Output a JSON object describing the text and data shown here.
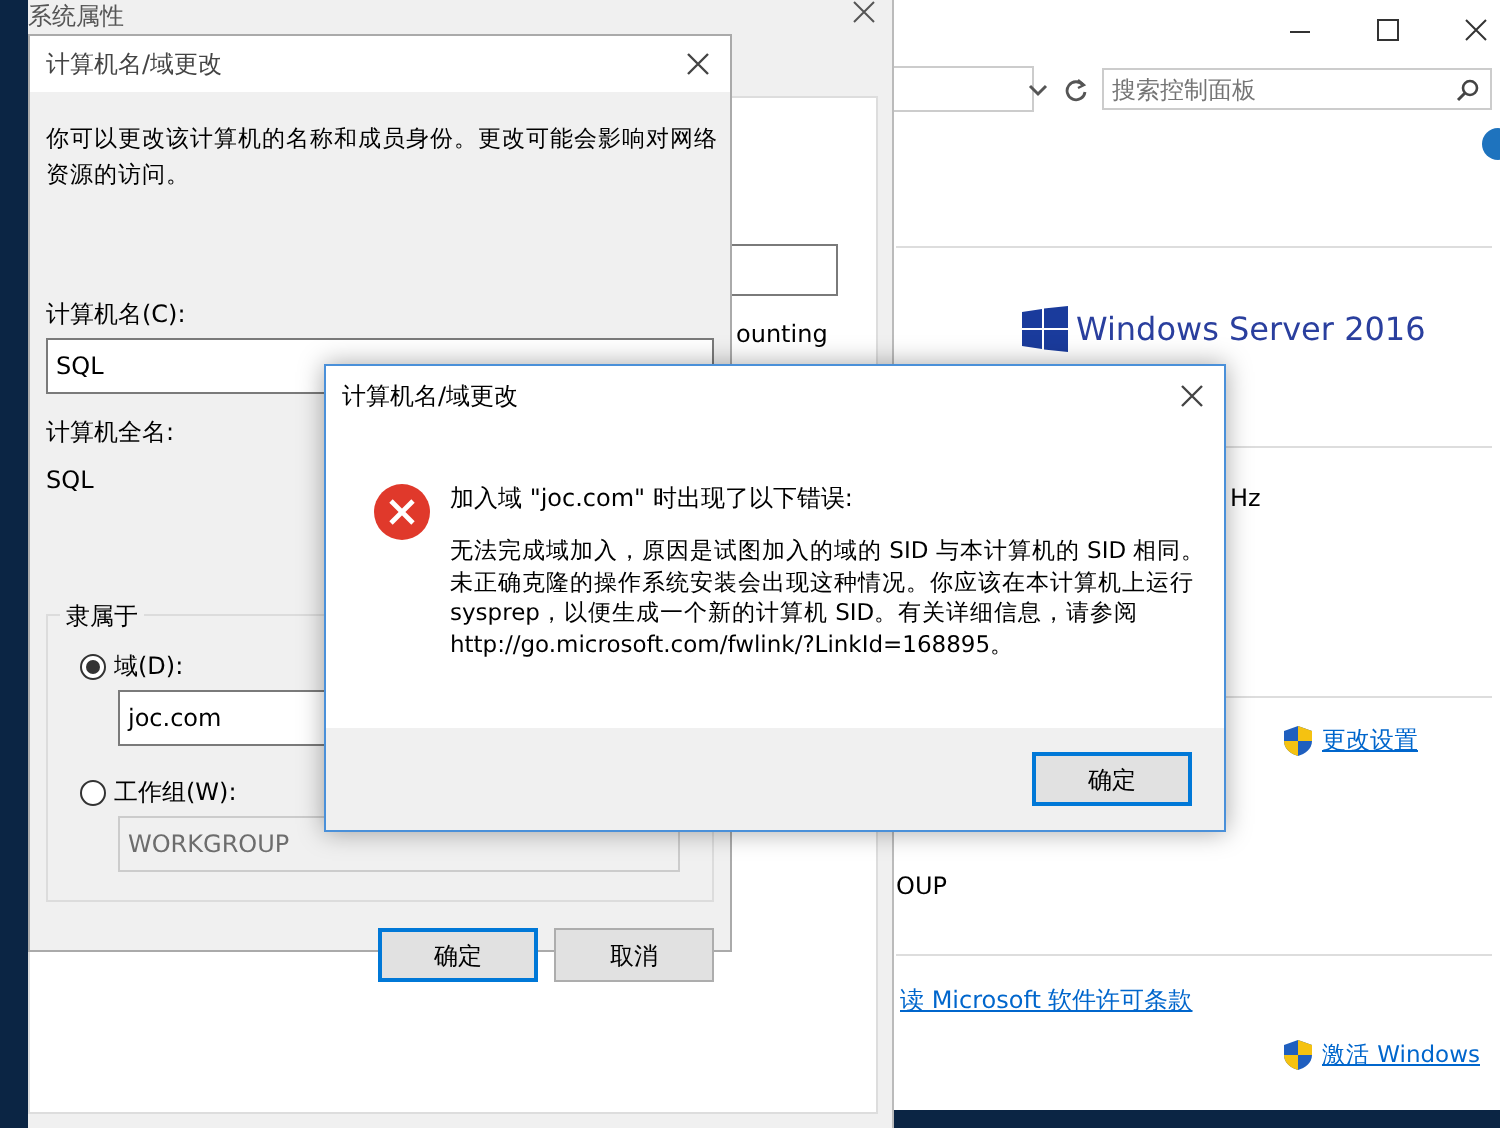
{
  "control_panel": {
    "search": {
      "placeholder": "搜索控制面板"
    },
    "brand": "Windows Server 2016",
    "fragments": [
      "Hz",
      "OUP"
    ],
    "change_settings_link": "更改设置",
    "license_link": "读 Microsoft 软件许可条款",
    "activate_link": "激活 Windows"
  },
  "system_properties": {
    "title": "系统属性",
    "fragment": "ounting"
  },
  "name_dialog": {
    "title": "计算机名/域更改",
    "description": "你可以更改该计算机的名称和成员身份。更改可能会影响对网络资源的访问。",
    "computer_name_label": "计算机名(C):",
    "computer_name": "SQL",
    "full_name_label": "计算机全名:",
    "full_name": "SQL",
    "member_of": "隶属于",
    "options": [
      {
        "label": "域(D):",
        "selected": true,
        "value": "joc.com",
        "disabled": false
      },
      {
        "label": "工作组(W):",
        "selected": false,
        "value": "WORKGROUP",
        "disabled": true
      }
    ],
    "buttons": [
      {
        "label": "确定",
        "default": true
      },
      {
        "label": "取消",
        "default": false
      }
    ]
  },
  "error_dialog": {
    "title": "计算机名/域更改",
    "heading": "加入域 \"joc.com\" 时出现了以下错误:",
    "message_lines": [
      "无法完成域加入，原因是试图加入的域的 SID 与本计算机的 SID 相同。",
      "未正确克隆的操作系统安装会出现这种情况。你应该在本计算机上运行",
      "sysprep，以便生成一个新的计算机 SID。有关详细信息，请参阅",
      "http://go.microsoft.com/fwlink/?LinkId=168895。"
    ],
    "buttons": [
      {
        "label": "确定",
        "default": true
      }
    ]
  }
}
